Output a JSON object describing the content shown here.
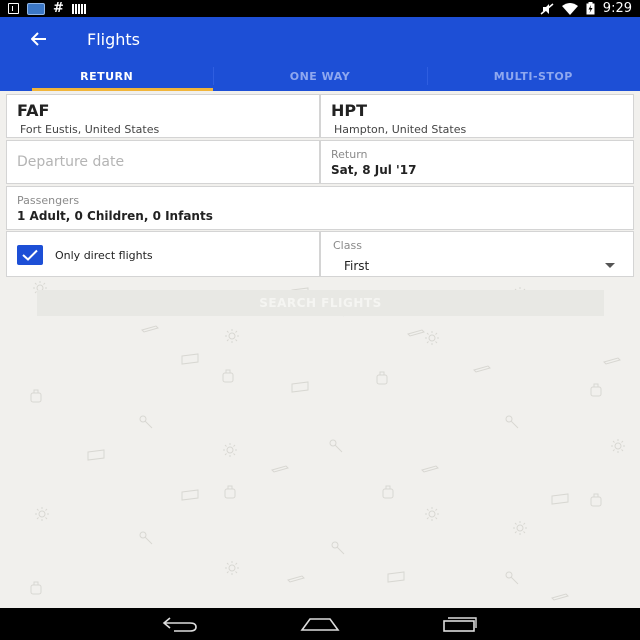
{
  "status_bar": {
    "time": "9:29",
    "left_icons": [
      "download-icon",
      "photo-icon",
      "hash-icon",
      "barcode-icon"
    ],
    "right_icons": [
      "mute-icon",
      "wifi-icon",
      "battery-charging-icon"
    ]
  },
  "app_bar": {
    "title": "Flights",
    "back_icon": "arrow-back-icon",
    "background": "#1d4fd6"
  },
  "tabs": [
    {
      "label": "RETURN",
      "active": true
    },
    {
      "label": "ONE WAY",
      "active": false
    },
    {
      "label": "MULTI-STOP",
      "active": false
    }
  ],
  "accent": "#f1b53a",
  "origin": {
    "code": "FAF",
    "city": "Fort Eustis, United States"
  },
  "destination": {
    "code": "HPT",
    "city": "Hampton, United States"
  },
  "departure": {
    "placeholder": "Departure date"
  },
  "return_date": {
    "label": "Return",
    "value": "Sat, 8 Jul '17"
  },
  "passengers": {
    "label": "Passengers",
    "value": "1 Adult, 0 Children, 0 Infants"
  },
  "direct_flights": {
    "label": "Only direct flights",
    "checked": true
  },
  "class_select": {
    "label": "Class",
    "value": "First"
  },
  "search_button": {
    "label": "SEARCH FLIGHTS"
  },
  "nav_bar": {
    "icons": [
      "back-nav-icon",
      "home-nav-icon",
      "recents-nav-icon"
    ]
  }
}
